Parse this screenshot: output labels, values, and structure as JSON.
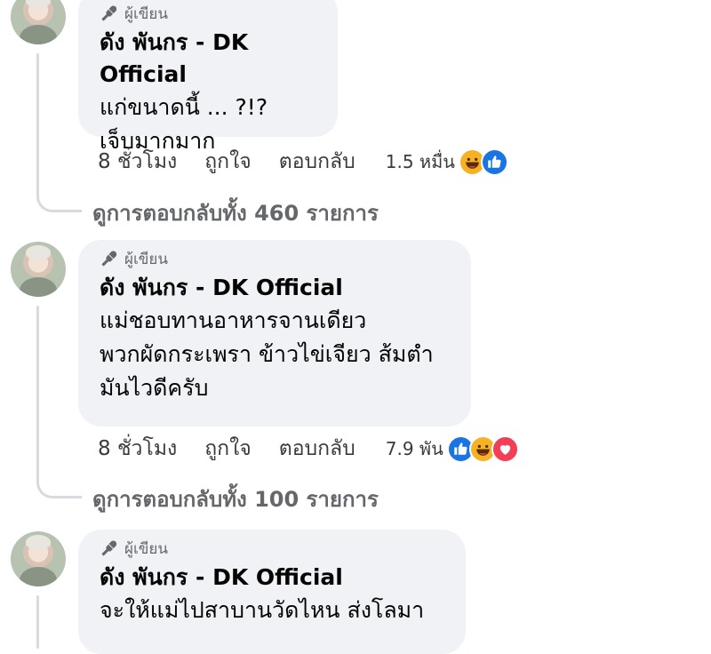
{
  "badge_label": "ผู้เขียน",
  "comments": [
    {
      "author": "ดัง พันกร - DK Official",
      "lines": [
        "แก่ขนาดนี้ ... ?!?",
        "เจ็บมากมาก"
      ],
      "time": "8 ชั่วโมง",
      "like_label": "ถูกใจ",
      "reply_label": "ตอบกลับ",
      "reaction_count": "1.5 หมื่น",
      "reactions": [
        "haha",
        "like"
      ],
      "view_replies": "ดูการตอบกลับทั้ง 460 รายการ"
    },
    {
      "author": "ดัง พันกร - DK Official",
      "lines": [
        "แม่ชอบทานอาหารจานเดียว",
        "พวกผัดกระเพรา ข้าวไข่เจียว ส้มตำ",
        "มันไวดีครับ"
      ],
      "time": "8 ชั่วโมง",
      "like_label": "ถูกใจ",
      "reply_label": "ตอบกลับ",
      "reaction_count": "7.9 พัน",
      "reactions": [
        "like",
        "haha",
        "love"
      ],
      "view_replies": "ดูการตอบกลับทั้ง 100 รายการ"
    },
    {
      "author": "ดัง พันกร - DK Official",
      "lines": [
        "จะให้แม่ไปสาบานวัดไหน ส่งโลมา"
      ]
    }
  ],
  "colors": {
    "bubble": "#f0f2f5",
    "like": "#1b74e4",
    "haha": "#f7b125",
    "love": "#f33e58",
    "muted": "#65676b"
  }
}
